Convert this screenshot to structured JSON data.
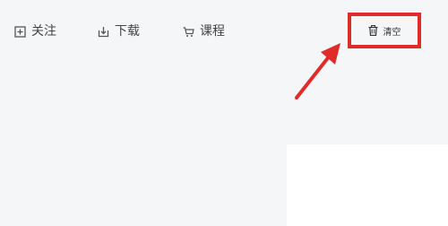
{
  "toolbar": {
    "follow": {
      "label": "关注",
      "icon": "add-box-icon"
    },
    "download": {
      "label": "下载",
      "icon": "download-icon"
    },
    "course": {
      "label": "课程",
      "icon": "cart-icon"
    },
    "clear": {
      "label": "清空",
      "icon": "trash-icon"
    }
  },
  "annotation": {
    "highlight_color": "#e02b2b"
  },
  "colors": {
    "background": "#f5f6f8",
    "panel": "#ffffff",
    "text": "#444444"
  }
}
